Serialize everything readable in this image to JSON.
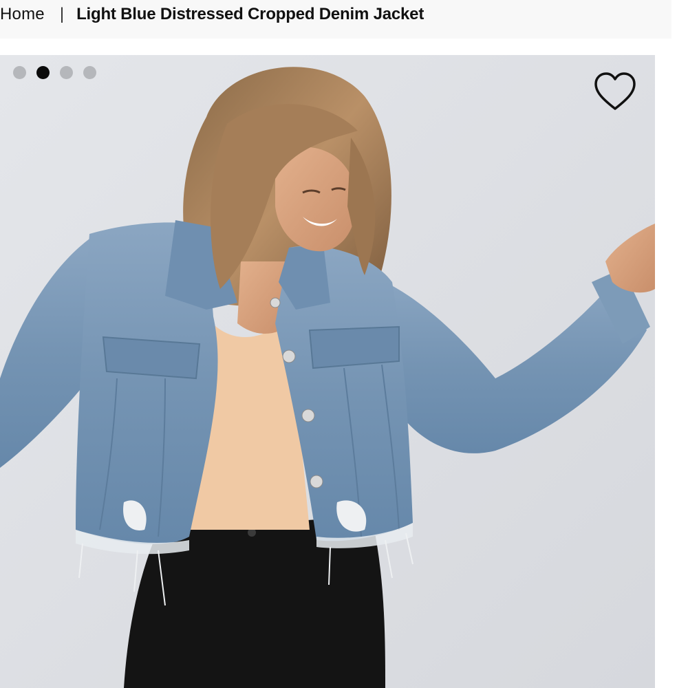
{
  "breadcrumb": {
    "home_label": "Home",
    "separator": "|",
    "current_label": "Light Blue Distressed Cropped Denim Jacket"
  },
  "gallery": {
    "slide_count": 4,
    "active_slide": 2,
    "image_alt": "Model wearing light blue distressed cropped denim jacket over a nude tank top and black jeans",
    "wishlist_icon": "heart-outline-icon"
  },
  "colors": {
    "background": "#dfe1e6",
    "denim": "#7a98b6",
    "dot_inactive": "#b5b7bb",
    "dot_active": "#0b0b0b"
  }
}
